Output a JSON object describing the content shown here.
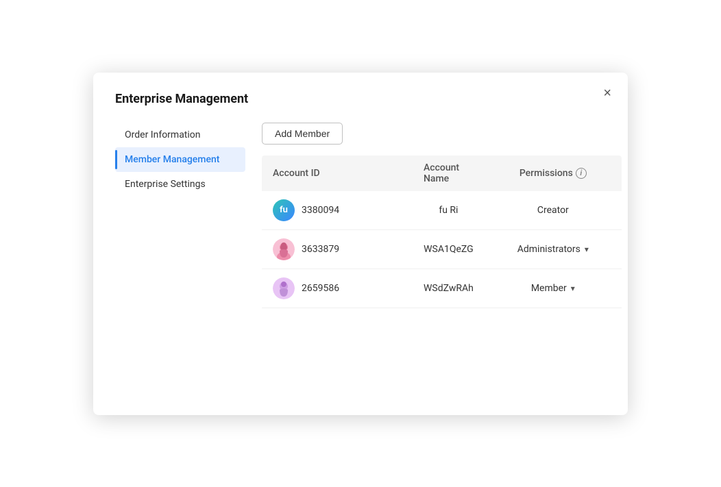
{
  "modal": {
    "title": "Enterprise Management",
    "close_label": "×"
  },
  "sidebar": {
    "items": [
      {
        "id": "order-information",
        "label": "Order Information",
        "active": false
      },
      {
        "id": "member-management",
        "label": "Member Management",
        "active": true
      },
      {
        "id": "enterprise-settings",
        "label": "Enterprise Settings",
        "active": false
      }
    ]
  },
  "main": {
    "add_member_button": "Add Member",
    "table": {
      "headers": [
        {
          "id": "account-id",
          "label": "Account ID"
        },
        {
          "id": "account-name",
          "label": "Account Name"
        },
        {
          "id": "permissions",
          "label": "Permissions"
        }
      ],
      "rows": [
        {
          "id": "row-1",
          "account_id": "3380094",
          "account_name": "fu Ri",
          "permissions": "Creator",
          "avatar_type": "initials",
          "avatar_text": "fu",
          "has_dropdown": false
        },
        {
          "id": "row-2",
          "account_id": "3633879",
          "account_name": "WSA1QeZG",
          "permissions": "Administrators",
          "avatar_type": "user-icon",
          "avatar_color": "#f7a8c4",
          "has_dropdown": true
        },
        {
          "id": "row-3",
          "account_id": "2659586",
          "account_name": "WSdZwRAh",
          "permissions": "Member",
          "avatar_type": "user-icon",
          "avatar_color": "#c9a8f7",
          "has_dropdown": true
        }
      ]
    }
  },
  "icons": {
    "info": "i",
    "chevron_down": "▾",
    "close": "✕"
  }
}
